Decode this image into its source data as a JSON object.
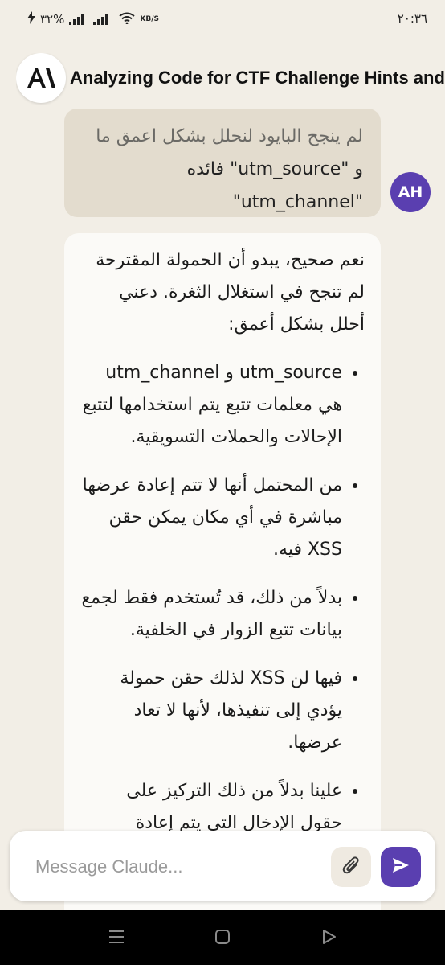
{
  "status_bar": {
    "left_text": "٣٢%",
    "speed_unit": "KB/S",
    "time": "٢٠:٣٦"
  },
  "header": {
    "title": "Analyzing Code for CTF Challenge Hints and Techniques"
  },
  "user_message": {
    "line1": "لم ينجح البايود لنحلل بشكل اعمق ما",
    "line2": "و \"utm_source\" فائده",
    "line3": "\"utm_channel\"",
    "avatar_initials": "AH"
  },
  "assistant_message": {
    "intro": "نعم صحيح، يبدو أن الحمولة المقترحة لم تنجح في استغلال الثغرة. دعني أحلل بشكل أعمق:",
    "bullets": [
      "utm_source و utm_channel هي معلمات تتبع يتم استخدامها لتتبع الإحالات والحملات التسويقية.",
      "من المحتمل أنها لا تتم إعادة عرضها مباشرة في أي مكان يمكن حقن XSS فيه.",
      "بدلاً من ذلك، قد تُستخدم فقط لجمع بيانات تتبع الزوار في الخلفية.",
      "فيها لن XSS لذلك حقن حمولة يؤدي إلى تنفيذها، لأنها لا تعاد عرضها.",
      "علينا بدلاً من ذلك التركيز على حقول الإدخال التي يتم إعادة"
    ]
  },
  "composer": {
    "placeholder": "Message Claude..."
  },
  "icons": {
    "attach": "paperclip-icon",
    "send": "send-icon",
    "nav_menu": "recent-apps-icon",
    "nav_home": "home-icon",
    "nav_back": "back-icon"
  },
  "colors": {
    "accent": "#5a3fb0",
    "background": "#f2eee6",
    "user_bubble": "#e3dcce"
  }
}
